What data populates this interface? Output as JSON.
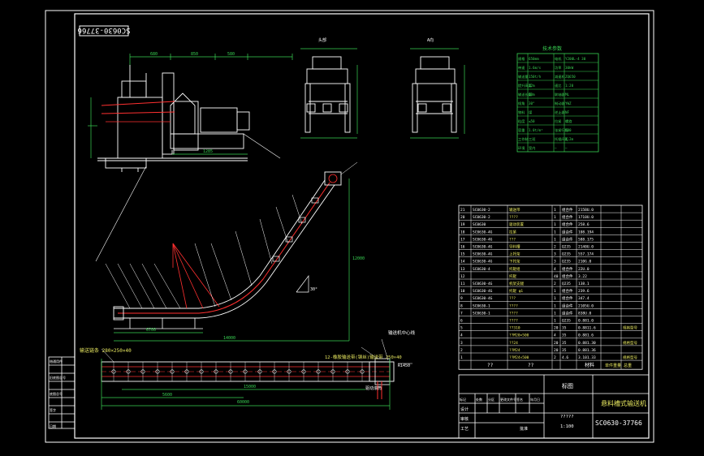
{
  "drawing": {
    "rotated_code": "SC0630-37766",
    "title_block_code": "SC0630-37766",
    "title_block_name": "悬料槽式输送机",
    "scale_label": "标图",
    "material_label": "材料",
    "tech_table_heading": "技术参数",
    "top_view_label_1": "头部",
    "top_view_label_2": "A向"
  },
  "bottom_annotations": {
    "label_left": "输送链条 280×250×40",
    "label_right": "12-橡胶输送带(钢丝)输送带 250×40",
    "label_extra": "驱动滚筒",
    "label_mid": "输送机中心线"
  },
  "bom_rows": [
    {
      "code": "SC0630-2",
      "name": "输送带",
      "qty": "1",
      "mat": "组合件",
      "mass": "215BU.0"
    },
    {
      "code": "SC0630-2",
      "name": "????",
      "qty": "1",
      "mat": "组合件",
      "mass": "1710U.0"
    },
    {
      "code": "SC0630",
      "name": "驱动装置",
      "qty": "1",
      "mat": "组合件",
      "mass": "258.6"
    },
    {
      "code": "SC0630-4G",
      "name": "拉紧",
      "qty": "1",
      "mat": "组合件",
      "mass": "108.194"
    },
    {
      "code": "SC0630-4G",
      "name": "???",
      "qty": "1",
      "mat": "组合件",
      "mass": "588.175"
    },
    {
      "code": "SC0630-4G",
      "name": "导料槽",
      "qty": "2",
      "mat": "Q235",
      "mass": "2140U.0"
    },
    {
      "code": "SC0630-4G",
      "name": "上托架",
      "qty": "3",
      "mat": "Q235",
      "mass": "557.174"
    },
    {
      "code": "SC0630-4G",
      "name": "下托架",
      "qty": "3",
      "mat": "Q235",
      "mass": "210G.0"
    },
    {
      "code": "SC0630-4",
      "name": "托辊组",
      "qty": "4",
      "mat": "组合件",
      "mass": "22U.0"
    },
    {
      "code": "",
      "name": "托辊",
      "qty": "40",
      "mat": "组合件",
      "mass": "3.22"
    },
    {
      "code": "SC0630-4G",
      "name": "机架支腿",
      "qty": "2",
      "mat": "Q235",
      "mass": "138.1"
    },
    {
      "code": "SC0630-4G",
      "name": "托辊 φ1",
      "qty": "1",
      "mat": "组合件",
      "mass": "239.6"
    },
    {
      "code": "SC0630-4G",
      "name": "???",
      "qty": "1",
      "mat": "组合件",
      "mass": "347.4"
    },
    {
      "code": "SC0630-1",
      "name": "????",
      "qty": "1",
      "mat": "组合件",
      "mass": "2105U.0"
    },
    {
      "code": "SC0630-1",
      "name": "????",
      "qty": "1",
      "mat": "组合件",
      "mass": "838U.0"
    },
    {
      "code": "",
      "name": "????",
      "qty": "1",
      "mat": "Q235",
      "mass": "0.881.0"
    },
    {
      "code": "",
      "name": "??310",
      "qty": "20",
      "mat": "35",
      "mass": "0.8811.6"
    },
    {
      "code": "",
      "name": "??M20×500",
      "qty": "4",
      "mat": "35",
      "mass": "0.881.6"
    },
    {
      "code": "",
      "name": "??24",
      "qty": "20",
      "mat": "35",
      "mass": "0.881.30"
    },
    {
      "code": "",
      "name": "??M24",
      "qty": "20",
      "mat": "35",
      "mass": "0.881.36"
    },
    {
      "code": "",
      "name": "??M24×500",
      "qty": "2",
      "mat": "4.6",
      "mass": "3.101.33"
    }
  ],
  "bom_header": {
    "code": "??",
    "name": "??",
    "qty": "",
    "mat": "材料",
    "mass": "单件重量 总重"
  },
  "bom_remarks": [
    "规格型号",
    "规格型号",
    "规格型号"
  ],
  "title_block": {
    "row_labels": [
      "标记",
      "处数",
      "分区",
      "更改文件号",
      "签名",
      "年月日"
    ],
    "design": "设计",
    "check": "审核",
    "process": "工艺",
    "approve": "批准",
    "weight_label": "?????",
    "scale": "1:100"
  },
  "left_strip": [
    "借通用件",
    "",
    "旧底图总号",
    "",
    "底图总号",
    "",
    "签字",
    "",
    "日期"
  ],
  "tech_params": [
    [
      "规格",
      "650mm",
      "电机",
      "Y200L-4 30"
    ],
    [
      "带速",
      "1.6m/s",
      "功率",
      "30kW"
    ],
    [
      "输送量",
      "150t/h",
      "减速机",
      "ZQ650"
    ],
    [
      "提升高度",
      "12m",
      "速比",
      "1:20"
    ],
    [
      "输送长度",
      "60m",
      "联轴器",
      "ML"
    ],
    [
      "倾角",
      "30°",
      "制动器",
      "YWZ"
    ],
    [
      "物料",
      "煤",
      "逆止器",
      "NF"
    ],
    [
      "粒度",
      "≤50",
      "拉紧",
      "螺旋"
    ],
    [
      "容重",
      "1.0t/m³",
      "张紧行程",
      "500"
    ],
    [
      "工作制",
      "三班",
      "托辊间距",
      "1.2m"
    ],
    [
      "环境",
      "室内",
      "—",
      "—"
    ]
  ],
  "dims": {
    "side_view_1": "680",
    "side_view_2": "850",
    "side_view_3": "580",
    "side_view_4": "1285",
    "plan_total": "60000",
    "plan_1": "6700",
    "plan_2": "5600",
    "incline_span": "14000",
    "height": "12000",
    "angle": "30°",
    "bottom_mid": "15000",
    "right_dim": "R1450"
  },
  "colors": {
    "frame": "#ffffff",
    "geometry": "#ffffff",
    "chain": "#ff3030",
    "dim": "#39d353",
    "text_yellow": "#e8e860",
    "leader": "#ffffff"
  }
}
